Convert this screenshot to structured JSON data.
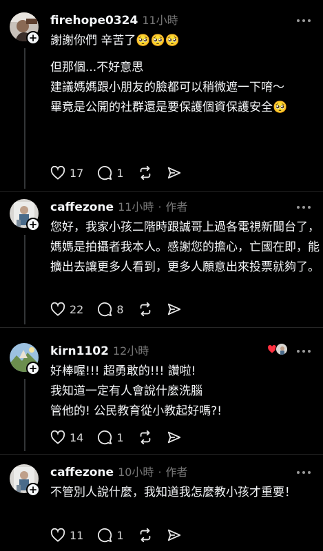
{
  "posts": [
    {
      "username": "firehope0324",
      "time": "11小時",
      "author_tag": "",
      "paragraphs": [
        "謝謝你們 辛苦了🥺🥺🥺",
        "但那個...不好意思",
        "建議媽媽跟小朋友的臉都可以稍微遮一下唷～",
        "畢竟是公開的社群還是要保護個資保護安全🥺"
      ],
      "likes": "17",
      "replies": "1"
    },
    {
      "username": "caffezone",
      "time": "11小時",
      "author_tag": "作者",
      "paragraphs": [
        "您好，我家小孩二階時跟誠哥上過各電視新聞台了，媽媽是拍攝者我本人。感謝您的擔心，亡國在即，能擴出去讓更多人看到，更多人願意出來投票就夠了。"
      ],
      "likes": "22",
      "replies": "8"
    },
    {
      "username": "kirn1102",
      "time": "12小時",
      "author_tag": "",
      "paragraphs": [
        "好棒喔!!! 超勇敢的!!! 讚啦!",
        "我知道一定有人會說什麼洗腦",
        "管他的! 公民教育從小教起好嗎?!"
      ],
      "likes": "14",
      "replies": "1"
    },
    {
      "username": "caffezone",
      "time": "10小時",
      "author_tag": "作者",
      "paragraphs": [
        "不管別人說什麼，我知道我怎麼教小孩才重要！"
      ],
      "likes": "11",
      "replies": "1"
    }
  ],
  "icons": {
    "like": "heart-icon",
    "reply": "comment-icon",
    "repost": "repost-icon",
    "share": "share-icon",
    "more": "more-icon"
  },
  "colors": {
    "background": "#000000",
    "text": "#f3f5f7",
    "muted": "#777777",
    "liked_heart": "#ff3040"
  }
}
